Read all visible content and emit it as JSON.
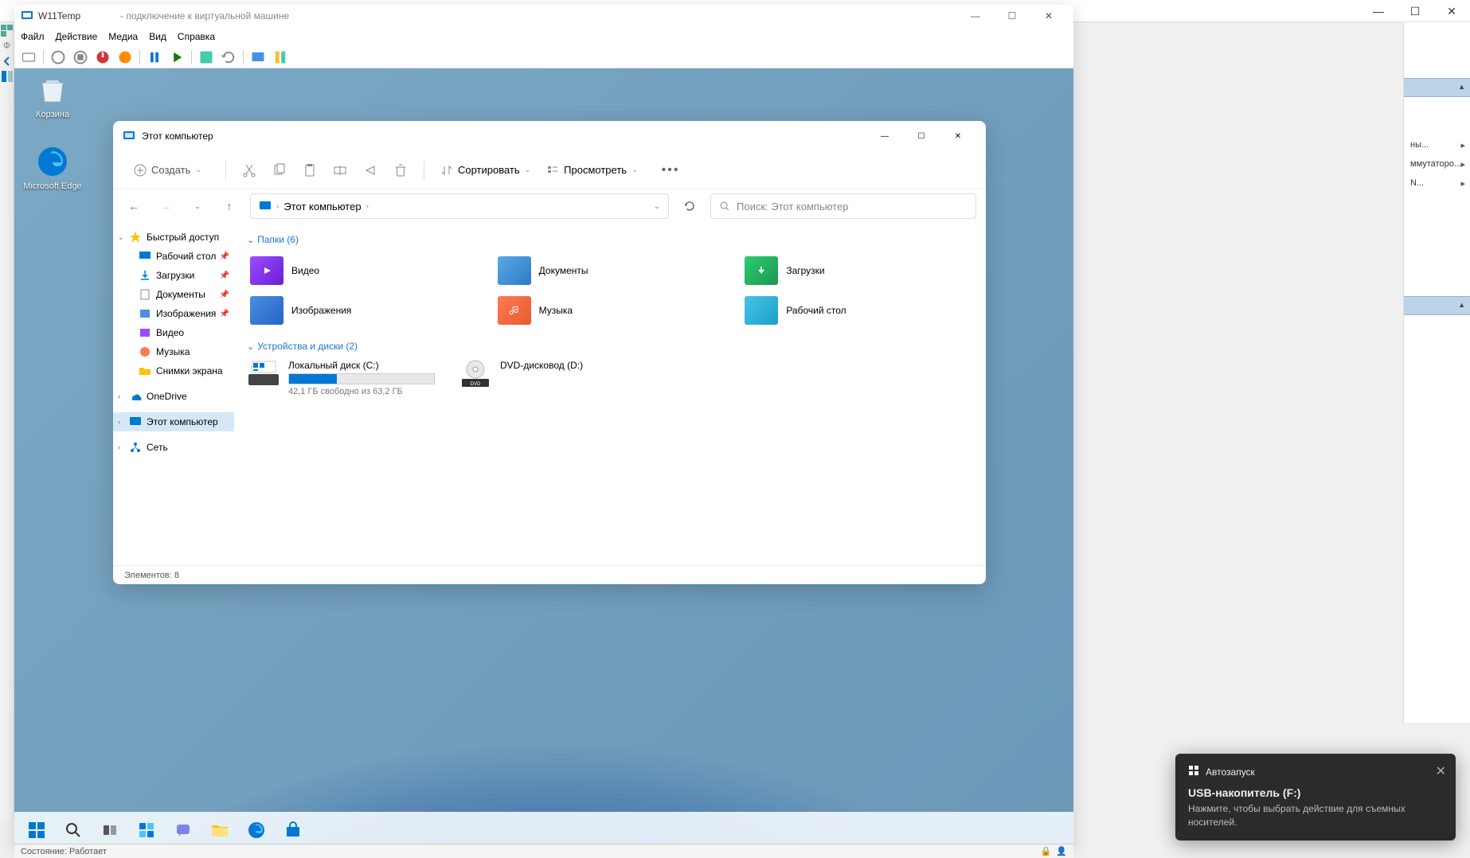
{
  "host": {
    "controls": {
      "min": "—",
      "max": "☐",
      "close": "✕"
    }
  },
  "hyperv": {
    "vm_name": "W11Temp",
    "subtitle": "- подключение к виртуальной машине",
    "menu": [
      "Файл",
      "Действие",
      "Медиа",
      "Вид",
      "Справка"
    ]
  },
  "desktop": {
    "icons": [
      {
        "name": "Корзина"
      },
      {
        "name": "Microsoft Edge"
      }
    ]
  },
  "explorer": {
    "title": "Этот компьютер",
    "new_label": "Создать",
    "sort_label": "Сортировать",
    "view_label": "Просмотреть",
    "breadcrumb": "Этот компьютер",
    "search_placeholder": "Поиск: Этот компьютер",
    "sidebar": {
      "quick_access": "Быстрый доступ",
      "items": [
        "Рабочий стол",
        "Загрузки",
        "Документы",
        "Изображения",
        "Видео",
        "Музыка",
        "Снимки экрана"
      ],
      "onedrive": "OneDrive",
      "this_pc": "Этот компьютер",
      "network": "Сеть"
    },
    "folders_header": "Папки (6)",
    "folders": [
      "Видео",
      "Документы",
      "Загрузки",
      "Изображения",
      "Музыка",
      "Рабочий стол"
    ],
    "drives_header": "Устройства и диски (2)",
    "drives": [
      {
        "name": "Локальный диск (C:)",
        "free_text": "42,1 ГБ свободно из 63,2 ГБ",
        "used_pct": 33
      },
      {
        "name": "DVD-дисковод (D:)"
      }
    ],
    "status": "Элементов: 8"
  },
  "toast": {
    "app": "Автозапуск",
    "title": "USB-накопитель (F:)",
    "body": "Нажмите, чтобы выбрать действие для съемных носителей."
  },
  "right_panel": {
    "items": [
      "ны...",
      "ммутаторо...",
      "N..."
    ]
  },
  "host_status": {
    "text": "Состояние: Работает"
  },
  "folder_colors": {
    "video": "linear-gradient(135deg,#9b4dff,#6a1fd4)",
    "docs": "linear-gradient(135deg,#5aa9e6,#2d7ac7)",
    "downloads": "linear-gradient(135deg,#2ecc71,#1a9850)",
    "images": "linear-gradient(135deg,#4a90e2,#2563c9)",
    "music": "linear-gradient(135deg,#ff7b54,#e85a2f)",
    "desktop": "linear-gradient(135deg,#4ac3e8,#1a9fc9)"
  }
}
